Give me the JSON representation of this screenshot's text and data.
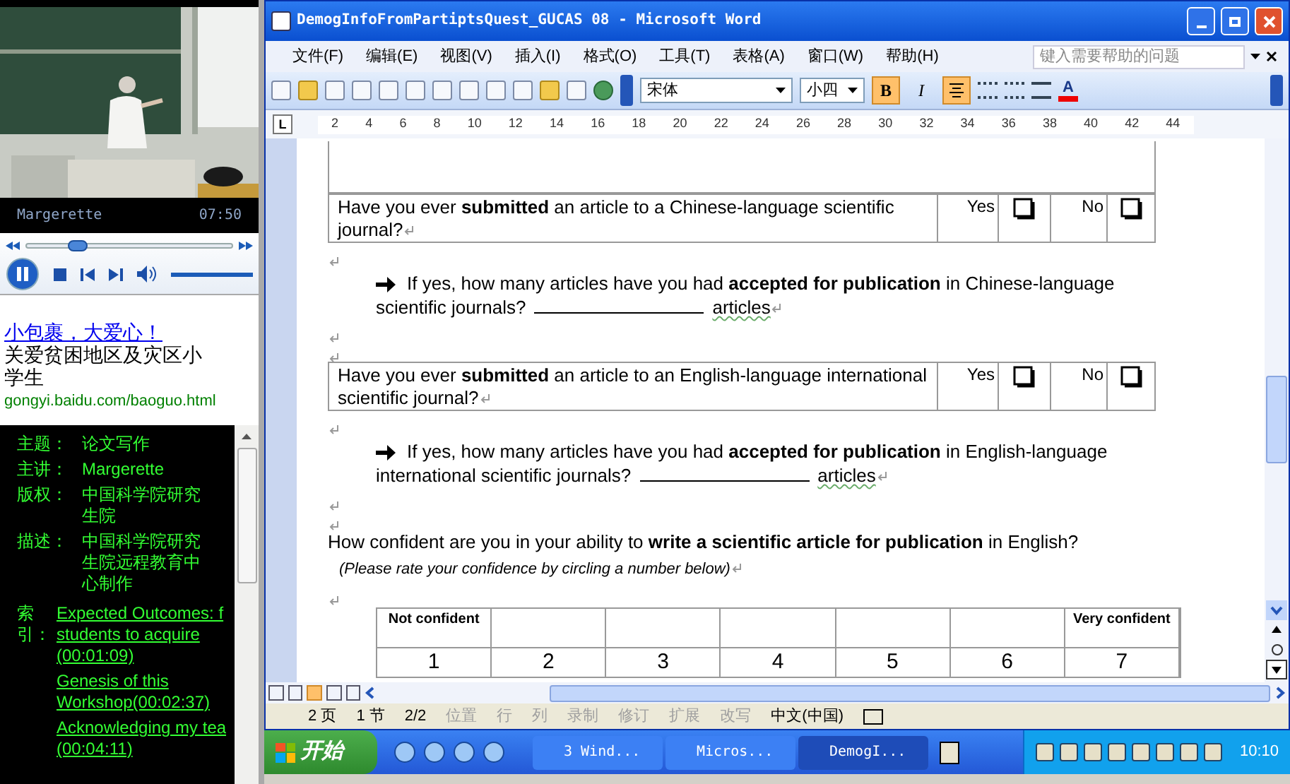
{
  "player": {
    "caption": "Margerette",
    "time": "07:50",
    "seek": {
      "level": 0.2
    },
    "volume": {
      "level": 1
    }
  },
  "ad": {
    "link": "小包裹，大爱心！",
    "text": "关爱贫困地区及灾区小学生",
    "url": "gongyi.baidu.com/baoguo.html"
  },
  "info": {
    "fields": [
      {
        "label": "主题：",
        "value": "论文写作"
      },
      {
        "label": "主讲：",
        "value": "Margerette"
      },
      {
        "label": "版权：",
        "value": "中国科学院研究生院"
      },
      {
        "label": "描述：",
        "value": "中国科学院研究生院远程教育中心制作"
      }
    ],
    "index_label": "索引：",
    "index": [
      {
        "lines": [
          "Expected Outcomes: f",
          "students to acquire",
          "(00:01:09)"
        ]
      },
      {
        "lines": [
          "Genesis of this",
          "Workshop(00:02:37)"
        ]
      },
      {
        "lines": [
          "Acknowledging my tea",
          "(00:04:11)"
        ]
      }
    ]
  },
  "window": {
    "title": "DemogInfoFromPartiptsQuest_GUCAS 08 - Microsoft Word"
  },
  "menu": [
    "文件(F)",
    "编辑(E)",
    "视图(V)",
    "插入(I)",
    "格式(O)",
    "工具(T)",
    "表格(A)",
    "窗口(W)",
    "帮助(H)"
  ],
  "help_search": {
    "placeholder": "键入需要帮助的问题"
  },
  "toolbar": {
    "font": "宋体",
    "size": "小四",
    "bold_label": "B",
    "italic_label": "I",
    "font_color_label": "A",
    "bold": true,
    "italic": false,
    "center": true
  },
  "ruler": {
    "tab_label": "L",
    "ticks": [
      "2",
      "4",
      "6",
      "8",
      "10",
      "12",
      "14",
      "16",
      "18",
      "20",
      "22",
      "24",
      "26",
      "28",
      "30",
      "32",
      "34",
      "36",
      "38",
      "40",
      "42",
      "44"
    ]
  },
  "document": [
    {
      "kind": "question",
      "text": "Have you ever **submitted** an article to a Chinese-language scientific journal?",
      "yes": "Yes",
      "no": "No"
    },
    {
      "kind": "followup",
      "text": "If yes, how many articles have you had **accepted for publication** in Chinese-language scientific journals?",
      "suffix": "articles"
    },
    {
      "kind": "question",
      "text": "Have you ever **submitted** an article to an English-language international scientific journal?",
      "yes": "Yes",
      "no": "No"
    },
    {
      "kind": "followup",
      "text": "If yes, how many articles have you had **accepted for publication** in English-language international scientific journals?",
      "suffix": "articles"
    },
    {
      "kind": "paragraph",
      "text": "How confident are you in your ability to **write a scientific article for publication** in English?",
      "note": "(Please rate your confidence by circling a number below)"
    },
    {
      "kind": "scale",
      "low": "Not confident",
      "high": "Very confident",
      "numbers": [
        "1",
        "2",
        "3",
        "4",
        "5",
        "6",
        "7"
      ]
    }
  ],
  "status_bar": [
    {
      "text": "2 页",
      "disabled": false
    },
    {
      "text": "1 节",
      "disabled": false
    },
    {
      "text": "2/2",
      "disabled": false
    },
    {
      "text": "位置",
      "disabled": true
    },
    {
      "text": "行",
      "disabled": true
    },
    {
      "text": "列",
      "disabled": true
    },
    {
      "text": "录制",
      "disabled": true
    },
    {
      "text": "修订",
      "disabled": true
    },
    {
      "text": "扩展",
      "disabled": true
    },
    {
      "text": "改写",
      "disabled": true
    },
    {
      "text": "中文(中国)",
      "disabled": false
    }
  ],
  "taskbar": {
    "start": "开始",
    "tasks": [
      {
        "label": "3 Wind...",
        "selected": false
      },
      {
        "label": "Micros...",
        "selected": false
      },
      {
        "label": "DemogI...",
        "selected": true
      }
    ],
    "clock": "10:10"
  }
}
